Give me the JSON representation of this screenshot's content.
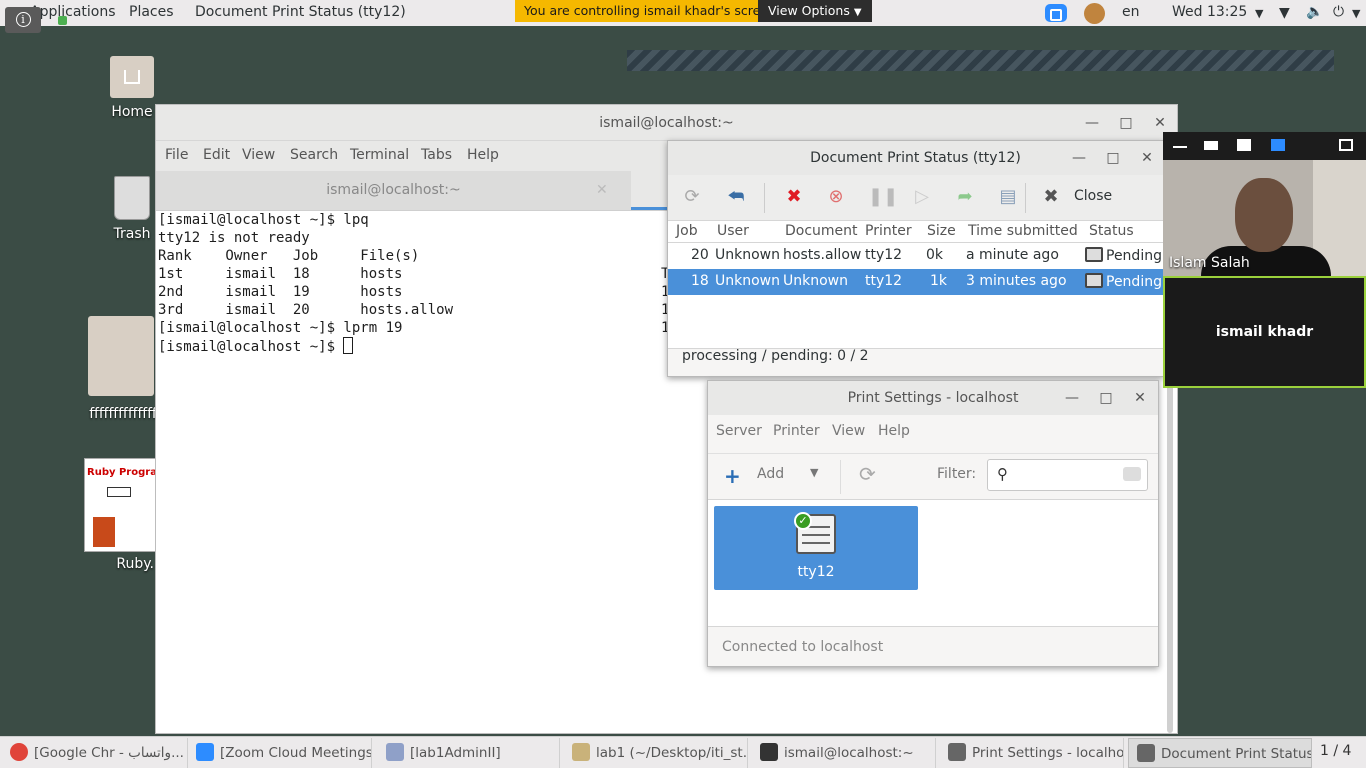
{
  "topbar": {
    "applications": "Applications",
    "places": "Places",
    "active_app": "Document Print Status (tty12)",
    "zoom_banner": "You are controlling ismail khadr's screen",
    "view_options": "View Options",
    "language": "en",
    "clock": "Wed 13:25",
    "info_glyph": "i"
  },
  "desktop": {
    "icons": [
      {
        "label": "Home",
        "icon": "home-folder-icon"
      },
      {
        "label": "Trash",
        "icon": "trash-icon"
      },
      {
        "label": "ffffffffffffff",
        "icon": "folder-icon"
      },
      {
        "label": "Ruby.",
        "icon": "document-thumbnail-icon"
      }
    ],
    "ruby_thumb_title": "Ruby Programmi"
  },
  "terminal": {
    "title": "ismail@localhost:~",
    "menu": [
      "File",
      "Edit",
      "View",
      "Search",
      "Terminal",
      "Tabs",
      "Help"
    ],
    "tab_label": "ismail@localhost:~",
    "lines": [
      "[ismail@localhost ~]$ lpq",
      "tty12 is not ready",
      "Rank    Owner   Job     File(s)",
      "1st     ismail  18      hosts",
      "2nd     ismail  19      hosts",
      "3rd     ismail  20      hosts.allow",
      "[ismail@localhost ~]$ lprm 19",
      "[ismail@localhost ~]$ "
    ],
    "right_col": [
      "T",
      "1",
      "1",
      "1"
    ]
  },
  "print_status": {
    "title": "Document Print Status (tty12)",
    "close_label": "Close",
    "columns": [
      "Job",
      "User",
      "Document",
      "Printer",
      "Size",
      "Time submitted",
      "Status"
    ],
    "rows": [
      {
        "job": "20",
        "user": "Unknown",
        "document": "hosts.allow",
        "printer": "tty12",
        "size": "0k",
        "time": "a minute ago",
        "status": "Pending"
      },
      {
        "job": "18",
        "user": "Unknown",
        "document": "Unknown",
        "printer": "tty12",
        "size": "1k",
        "time": "3 minutes ago",
        "status": "Pending"
      }
    ],
    "footer": "processing / pending:   0 / 2"
  },
  "print_settings": {
    "title": "Print Settings - localhost",
    "menu": [
      "Server",
      "Printer",
      "View",
      "Help"
    ],
    "add_label": "Add",
    "filter_label": "Filter:",
    "printer_name": "tty12",
    "status": "Connected to localhost"
  },
  "zoom_panel": {
    "participant_1": "Islam Salah",
    "participant_2": "ismail khadr"
  },
  "taskbar": {
    "items": [
      {
        "label": "[Google Chr - واتساب...",
        "icon": "chrome-icon",
        "color": "#e0443a"
      },
      {
        "label": "[Zoom Cloud Meetings]",
        "icon": "zoom-icon",
        "color": "#2d8cff"
      },
      {
        "label": "[lab1AdminII]",
        "icon": "document-icon",
        "color": "#8fa0c8"
      },
      {
        "label": "lab1 (~/Desktop/iti_st...",
        "icon": "text-editor-icon",
        "color": "#c9b27a"
      },
      {
        "label": "ismail@localhost:~",
        "icon": "terminal-icon",
        "color": "#333333"
      },
      {
        "label": "Print Settings - localhost",
        "icon": "printer-icon",
        "color": "#666666"
      },
      {
        "label": "Document Print Status...",
        "icon": "printer-icon",
        "color": "#666666"
      }
    ],
    "pager": "1 / 4"
  },
  "colors": {
    "selection": "#4a90d9",
    "desktop_bg": "#3b4c45",
    "zoom_banner": "#f5b800",
    "active_speaker_border": "#9bd13c"
  }
}
